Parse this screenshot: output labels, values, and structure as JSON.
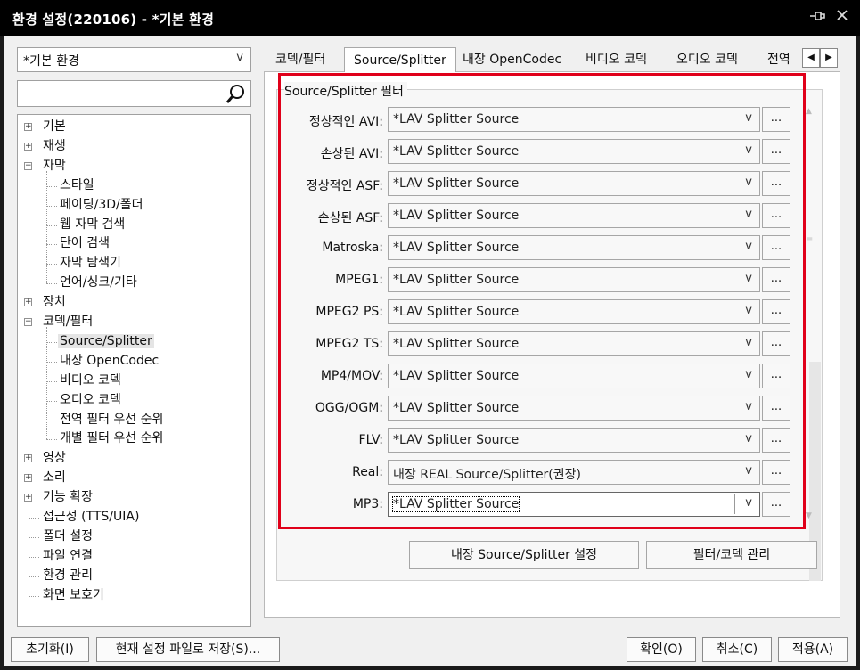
{
  "window": {
    "title": "환경 설정(220106) - *기본 환경"
  },
  "profile_combo": {
    "value": "*기본 환경"
  },
  "search": {
    "placeholder": ""
  },
  "tree": [
    {
      "label": "기본",
      "level": 0,
      "expander": "+"
    },
    {
      "label": "재생",
      "level": 0,
      "expander": "+"
    },
    {
      "label": "자막",
      "level": 0,
      "expander": "-"
    },
    {
      "label": "스타일",
      "level": 1
    },
    {
      "label": "페이딩/3D/폴더",
      "level": 1
    },
    {
      "label": "웹 자막 검색",
      "level": 1
    },
    {
      "label": "단어 검색",
      "level": 1
    },
    {
      "label": "자막 탐색기",
      "level": 1
    },
    {
      "label": "언어/싱크/기타",
      "level": 1
    },
    {
      "label": "장치",
      "level": 0,
      "expander": "+"
    },
    {
      "label": "코덱/필터",
      "level": 0,
      "expander": "-"
    },
    {
      "label": "Source/Splitter",
      "level": 1,
      "selected": true
    },
    {
      "label": "내장 OpenCodec",
      "level": 1
    },
    {
      "label": "비디오 코덱",
      "level": 1
    },
    {
      "label": "오디오 코덱",
      "level": 1
    },
    {
      "label": "전역 필터 우선 순위",
      "level": 1
    },
    {
      "label": "개별 필터 우선 순위",
      "level": 1
    },
    {
      "label": "영상",
      "level": 0,
      "expander": "+"
    },
    {
      "label": "소리",
      "level": 0,
      "expander": "+"
    },
    {
      "label": "기능 확장",
      "level": 0,
      "expander": "+"
    },
    {
      "label": "접근성 (TTS/UIA)",
      "level": 0
    },
    {
      "label": "폴더 설정",
      "level": 0
    },
    {
      "label": "파일 연결",
      "level": 0
    },
    {
      "label": "환경 관리",
      "level": 0
    },
    {
      "label": "화면 보호기",
      "level": 0
    }
  ],
  "tabs": [
    {
      "label": "코덱/필터"
    },
    {
      "label": "Source/Splitter",
      "active": true
    },
    {
      "label": "내장 OpenCodec"
    },
    {
      "label": "비디오 코덱"
    },
    {
      "label": "오디오 코덱"
    },
    {
      "label": "전역"
    }
  ],
  "group": {
    "title": "Source/Splitter 필터",
    "rows": [
      {
        "label": "정상적인 AVI:",
        "value": "*LAV Splitter Source"
      },
      {
        "label": "손상된 AVI:",
        "value": "*LAV Splitter Source"
      },
      {
        "label": "정상적인 ASF:",
        "value": "*LAV Splitter Source"
      },
      {
        "label": "손상된 ASF:",
        "value": "*LAV Splitter Source"
      },
      {
        "label": "Matroska:",
        "value": "*LAV Splitter Source"
      },
      {
        "label": "MPEG1:",
        "value": "*LAV Splitter Source"
      },
      {
        "label": "MPEG2 PS:",
        "value": "*LAV Splitter Source"
      },
      {
        "label": "MPEG2 TS:",
        "value": "*LAV Splitter Source"
      },
      {
        "label": "MP4/MOV:",
        "value": "*LAV Splitter Source"
      },
      {
        "label": "OGG/OGM:",
        "value": "*LAV Splitter Source"
      },
      {
        "label": "FLV:",
        "value": "*LAV Splitter Source"
      },
      {
        "label": "Real:",
        "value": "내장 REAL Source/Splitter(권장)"
      },
      {
        "label": "MP3:",
        "value": "*LAV Splitter Source",
        "focused": true
      }
    ],
    "dots_label": "...",
    "arrow_glyph": "v"
  },
  "actions": {
    "builtin_settings": "내장 Source/Splitter 설정",
    "filter_manage": "필터/코덱 관리"
  },
  "bottom": {
    "reset": "초기화(I)",
    "save_as": "현재 설정 파일로 저장(S)...",
    "ok": "확인(O)",
    "cancel": "취소(C)",
    "apply": "적용(A)"
  },
  "colors": {
    "highlight": "#e0001a",
    "titlebar": "#000000"
  }
}
